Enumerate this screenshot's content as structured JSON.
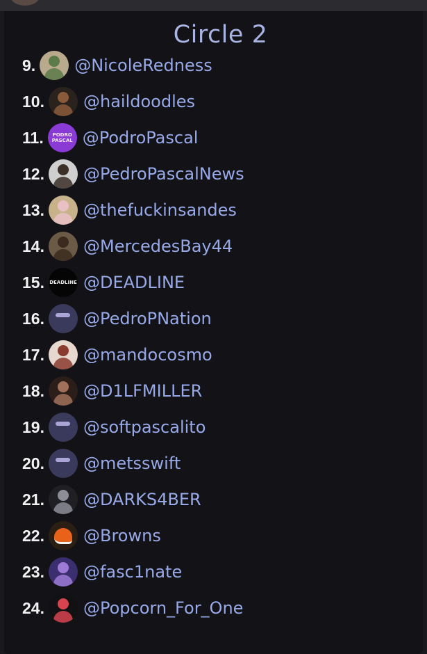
{
  "header": {
    "title": "Circle 2"
  },
  "items": [
    {
      "rank": "9.",
      "handle": "@NicoleRedness",
      "avatar": {
        "icon": "couple-photo-icon",
        "bg": "#b9aa8e",
        "fg": "#5c7a4a"
      }
    },
    {
      "rank": "10.",
      "handle": "@haildoodles",
      "avatar": {
        "icon": "bearded-man-photo-icon",
        "bg": "#2a221c",
        "fg": "#8a5a3a"
      }
    },
    {
      "rank": "11.",
      "handle": "@PodroPascal",
      "avatar": {
        "icon": "podro-pascal-logo-icon",
        "bg": "#8a3bd6",
        "fg": "#f4e8ff",
        "text": "PODRO PASCAL"
      }
    },
    {
      "rank": "12.",
      "handle": "@PedroPascalNews",
      "avatar": {
        "icon": "man-portrait-icon",
        "bg": "#cfcfcf",
        "fg": "#3b2f27"
      }
    },
    {
      "rank": "13.",
      "handle": "@thefuckinsandes",
      "avatar": {
        "icon": "person-photo-icon",
        "bg": "#c8b28c",
        "fg": "#e9c0c4"
      }
    },
    {
      "rank": "14.",
      "handle": "@MercedesBay44",
      "avatar": {
        "icon": "guitarist-photo-icon",
        "bg": "#6b5a45",
        "fg": "#3b2b1f"
      }
    },
    {
      "rank": "15.",
      "handle": "@DEADLINE",
      "avatar": {
        "icon": "deadline-logo-icon",
        "bg": "#050505",
        "fg": "#e6e6e6",
        "text": "DEADLINE"
      }
    },
    {
      "rank": "16.",
      "handle": "@PedroPNation",
      "avatar": {
        "icon": "glasses-portrait-icon",
        "bg": "#3a3a5c",
        "fg": "#cfc6ff"
      }
    },
    {
      "rank": "17.",
      "handle": "@mandocosmo",
      "avatar": {
        "icon": "woman-portrait-icon",
        "bg": "#e6d8cf",
        "fg": "#8a3b2f"
      }
    },
    {
      "rank": "18.",
      "handle": "@D1LFMILLER",
      "avatar": {
        "icon": "man-dark-photo-icon",
        "bg": "#2b1d17",
        "fg": "#a0705a"
      }
    },
    {
      "rank": "19.",
      "handle": "@softpascalito",
      "avatar": {
        "icon": "glasses-portrait-icon",
        "bg": "#3a3a5c",
        "fg": "#cfc6ff"
      }
    },
    {
      "rank": "20.",
      "handle": "@metsswift",
      "avatar": {
        "icon": "glasses-portrait-icon",
        "bg": "#3a3a5c",
        "fg": "#cfc6ff"
      }
    },
    {
      "rank": "21.",
      "handle": "@DARKS4BER",
      "avatar": {
        "icon": "person-dark-photo-icon",
        "bg": "#1f1f24",
        "fg": "#8d8d98"
      }
    },
    {
      "rank": "22.",
      "handle": "@Browns",
      "avatar": {
        "icon": "football-helmet-icon",
        "bg": "#2a1f12",
        "fg": "#e8621a"
      }
    },
    {
      "rank": "23.",
      "handle": "@fasc1nate",
      "avatar": {
        "icon": "galaxy-image-icon",
        "bg": "#3b2e6e",
        "fg": "#9c7ad6"
      }
    },
    {
      "rank": "24.",
      "handle": "@Popcorn_For_One",
      "avatar": {
        "icon": "popcorn-character-icon",
        "bg": "#111114",
        "fg": "#d7444f"
      }
    }
  ]
}
